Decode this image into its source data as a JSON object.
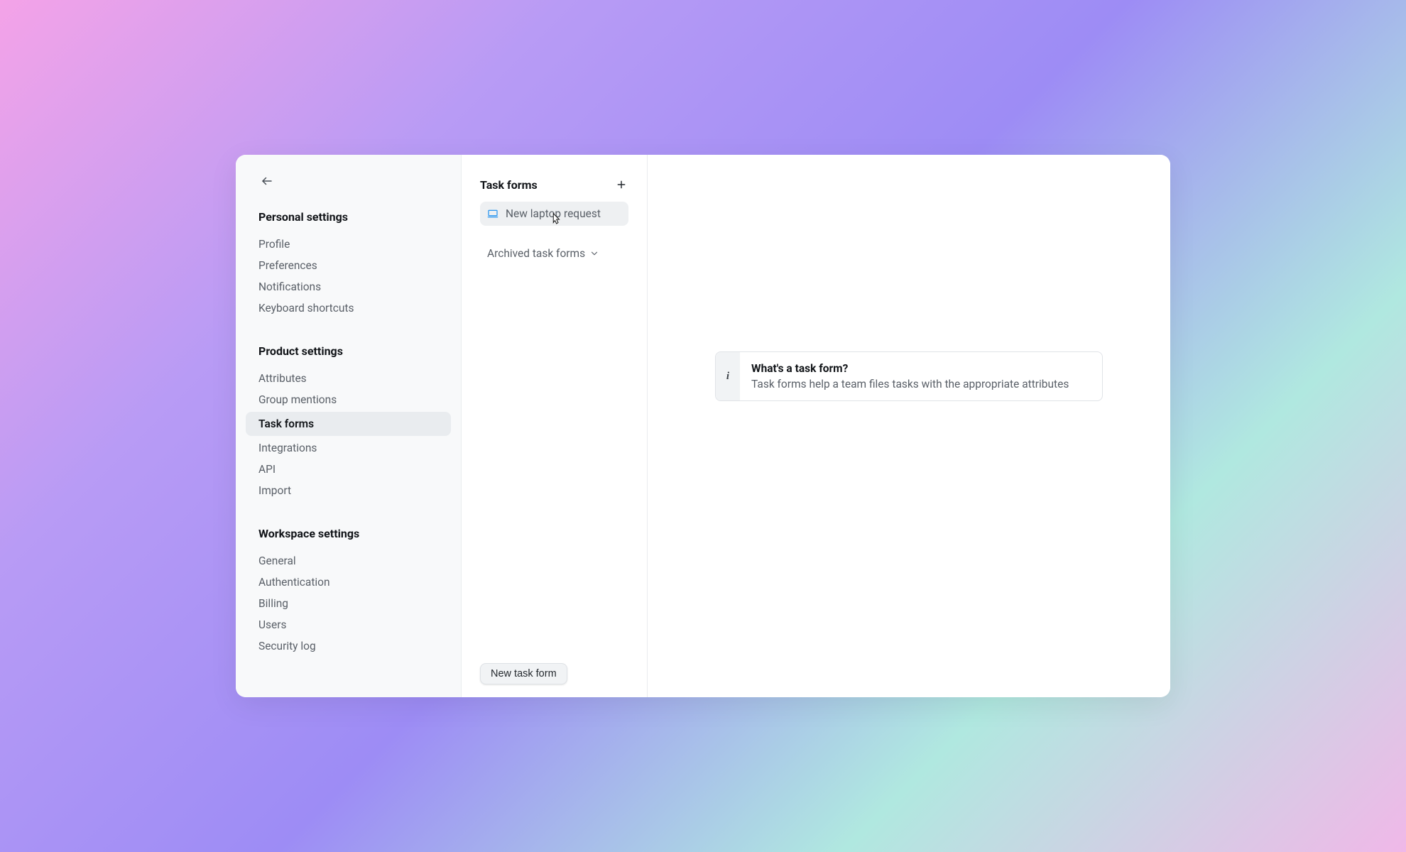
{
  "sidebar": {
    "sections": [
      {
        "heading": "Personal settings",
        "items": [
          "Profile",
          "Preferences",
          "Notifications",
          "Keyboard shortcuts"
        ],
        "active": null
      },
      {
        "heading": "Product settings",
        "items": [
          "Attributes",
          "Group mentions",
          "Task forms",
          "Integrations",
          "API",
          "Import"
        ],
        "active": "Task forms"
      },
      {
        "heading": "Workspace settings",
        "items": [
          "General",
          "Authentication",
          "Billing",
          "Users",
          "Security log"
        ],
        "active": null
      }
    ]
  },
  "middle": {
    "title": "Task forms",
    "forms": [
      {
        "label": "New laptop request"
      }
    ],
    "archived_label": "Archived task forms",
    "new_form_button": "New task form"
  },
  "main": {
    "info_title": "What's a task form?",
    "info_body": "Task forms help a team files tasks with the appropriate attributes"
  }
}
